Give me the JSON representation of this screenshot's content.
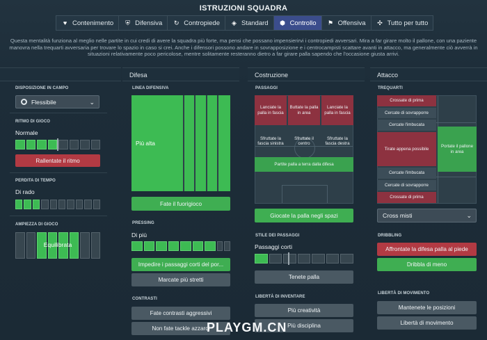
{
  "header": {
    "title": "ISTRUZIONI SQUADRA"
  },
  "tabs": [
    {
      "label": "Contenimento",
      "icon": "heart-shield-icon"
    },
    {
      "label": "Difensiva",
      "icon": "shield-icon"
    },
    {
      "label": "Contropiede",
      "icon": "counter-icon"
    },
    {
      "label": "Standard",
      "icon": "standard-icon"
    },
    {
      "label": "Controllo",
      "icon": "control-icon",
      "active": true
    },
    {
      "label": "Offensiva",
      "icon": "attack-icon"
    },
    {
      "label": "Tutto per tutto",
      "icon": "all-out-icon"
    }
  ],
  "description": "Questa mentalità funziona al meglio nelle partite in cui credi di avere la squadra più forte, ma pensi che possano impensierirvi i contropiedi avversari. Mira a far girare molto il pallone, con una paziente manovra nella trequarti avversaria per trovare lo spazio in caso si crei. Anche i difensori possono andare in sovrapposizione e i centrocampisti scattare avanti in attacco, ma generalmente ciò avverrà in situazioni relativamente poco pericolose, mentre solitamente resteranno dietro a far girare palla sapendo che l'occasione giusta arrivi.",
  "col1": {
    "formation_label": "DISPOSIZIONE IN CAMPO",
    "formation_value": "Flessibile",
    "tempo_label": "RITMO DI GIOCO",
    "tempo_value": "Normale",
    "tempo_level": 0.5,
    "tempo_button": "Rallentate il ritmo",
    "timewasting_label": "PERDITA DI TEMPO",
    "timewasting_value": "Di rado",
    "timewasting_level": 0.2,
    "width_label": "AMPIEZZA DI GIOCO",
    "width_value": "Equilibrata",
    "width_level": 0.5
  },
  "col2": {
    "heading": "Difesa",
    "line_label": "LINEA DIFENSIVA",
    "line_value": "Più alta",
    "line_button": "Fate il fuorigioco",
    "pressing_label": "PRESSING",
    "pressing_value": "Di più",
    "pressing_level": 0.7,
    "pressing_btn1": "Impedire i passaggi corti del por...",
    "pressing_btn2": "Marcate più stretti",
    "tackling_label": "CONTRASTI",
    "tackling_btn1": "Fate contrasti aggressivi",
    "tackling_btn2": "Non fate tackle azzardi"
  },
  "col3": {
    "heading": "Costruzione",
    "passes_label": "PASSAGGI",
    "zones": {
      "z1": "Lanciate la palla in fascia",
      "z2": "Buttate la palla in area",
      "z3": "Lanciate la palla in fascia",
      "z4": "Sfruttate la fascia sinistra",
      "z5": "Sfruttate il centro",
      "z6": "Sfruttate la fascia destra",
      "z7": "Partite palla a terra dalla difesa"
    },
    "space_button": "Giocate la palla negli spazi",
    "style_label": "STILE DEI PASSAGGI",
    "style_value": "Passaggi corti",
    "style_level": 0.2,
    "style_button": "Tenete palla",
    "freedom_label": "LIBERTÀ DI INVENTARE",
    "freedom_btn1": "Più creatività",
    "freedom_btn2": "Più disciplina"
  },
  "col4": {
    "heading": "Attacco",
    "third_label": "TREQUARTI",
    "zones": {
      "a1": "Crossate di prima",
      "a2": "Cercate di sovrapporre",
      "a3": "Cercate l'imbucata",
      "a4": "Tirate appena possibile",
      "a5": "Portate il pallone in area",
      "a6": "Cercate l'imbucata",
      "a7": "Cercate di sovrapporre",
      "a8": "Crossate di prima"
    },
    "cross_value": "Cross misti",
    "dribbling_label": "DRIBBLING",
    "dribbling_btn1": "Affrontate la difesa palla al piede",
    "dribbling_btn2": "Dribbla di meno",
    "movement_label": "LIBERTÀ DI MOVIMENTO",
    "movement_btn1": "Mantenete le posizioni",
    "movement_btn2": "Libertà di movimento"
  },
  "watermark": "PLAYGM.CN"
}
